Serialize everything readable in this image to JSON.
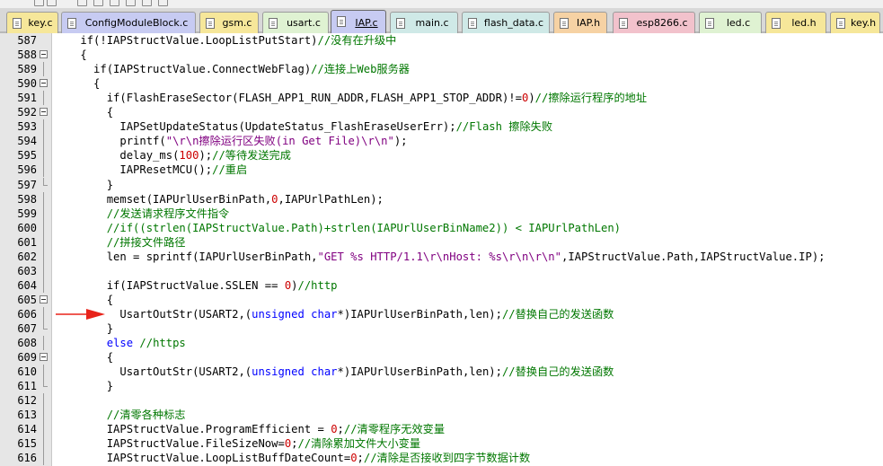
{
  "tabs": [
    {
      "label": "key.c",
      "color": "#f6e79a"
    },
    {
      "label": "ConfigModuleBlock.c",
      "color": "#c7cbf2"
    },
    {
      "label": "gsm.c",
      "color": "#f6e79a"
    },
    {
      "label": "usart.c",
      "color": "#dff2d2"
    },
    {
      "label": "IAP.c",
      "color": "#c7cbf2",
      "active": true
    },
    {
      "label": "main.c",
      "color": "#cfe9e7"
    },
    {
      "label": "flash_data.c",
      "color": "#cfe9e7"
    },
    {
      "label": "IAP.h",
      "color": "#f6d2a4"
    },
    {
      "label": "esp8266.c",
      "color": "#f2c2cc"
    },
    {
      "label": "led.c",
      "color": "#dff2d2"
    },
    {
      "label": "led.h",
      "color": "#f6e79a"
    },
    {
      "label": "key.h",
      "color": "#f6e79a"
    }
  ],
  "colors": {
    "comment": "#007700",
    "keyword": "#0000ff",
    "string": "#800080",
    "number": "#cc0000",
    "arrow": "#e8231a"
  },
  "current_line_marker": {
    "line": "606",
    "icon": "red-arrow-icon"
  },
  "lines": [
    {
      "n": "587",
      "fold": "none",
      "segs": [
        {
          "t": "    if(!IAPStructValue.LoopListPutStart)"
        },
        {
          "t": "//没有在升级中",
          "c": "comment"
        }
      ]
    },
    {
      "n": "588",
      "fold": "box",
      "segs": [
        {
          "t": "    {"
        }
      ]
    },
    {
      "n": "589",
      "fold": "line",
      "segs": [
        {
          "t": "      if(IAPStructValue.ConnectWebFlag)"
        },
        {
          "t": "//连接上Web服务器",
          "c": "comment"
        }
      ]
    },
    {
      "n": "590",
      "fold": "box",
      "segs": [
        {
          "t": "      {"
        }
      ]
    },
    {
      "n": "591",
      "fold": "line",
      "segs": [
        {
          "t": "        if(FlashEraseSector(FLASH_APP1_RUN_ADDR,FLASH_APP1_STOP_ADDR)!="
        },
        {
          "t": "0",
          "c": "number"
        },
        {
          "t": ")"
        },
        {
          "t": "//擦除运行程序的地址",
          "c": "comment"
        }
      ]
    },
    {
      "n": "592",
      "fold": "box",
      "segs": [
        {
          "t": "        {"
        }
      ]
    },
    {
      "n": "593",
      "fold": "line",
      "segs": [
        {
          "t": "          IAPSetUpdateStatus(UpdateStatus_FlashEraseUserErr);"
        },
        {
          "t": "//Flash 擦除失败",
          "c": "comment"
        }
      ]
    },
    {
      "n": "594",
      "fold": "line",
      "segs": [
        {
          "t": "          printf("
        },
        {
          "t": "\"\\r\\n擦除运行区失败(in Get File)\\r\\n\"",
          "c": "string"
        },
        {
          "t": ");"
        }
      ]
    },
    {
      "n": "595",
      "fold": "line",
      "segs": [
        {
          "t": "          delay_ms("
        },
        {
          "t": "100",
          "c": "number"
        },
        {
          "t": ");"
        },
        {
          "t": "//等待发送完成",
          "c": "comment"
        }
      ]
    },
    {
      "n": "596",
      "fold": "line",
      "segs": [
        {
          "t": "          IAPResetMCU();"
        },
        {
          "t": "//重启",
          "c": "comment"
        }
      ]
    },
    {
      "n": "597",
      "fold": "end",
      "segs": [
        {
          "t": "        }"
        }
      ]
    },
    {
      "n": "598",
      "fold": "line",
      "segs": [
        {
          "t": "        memset(IAPUrlUserBinPath,"
        },
        {
          "t": "0",
          "c": "number"
        },
        {
          "t": ",IAPUrlPathLen);"
        }
      ]
    },
    {
      "n": "599",
      "fold": "line",
      "segs": [
        {
          "t": "        //发送请求程序文件指令",
          "c": "comment"
        }
      ]
    },
    {
      "n": "600",
      "fold": "line",
      "segs": [
        {
          "t": "        //if((strlen(IAPStructValue.Path)+strlen(IAPUrlUserBinName2)) < IAPUrlPathLen)",
          "c": "comment"
        }
      ]
    },
    {
      "n": "601",
      "fold": "line",
      "segs": [
        {
          "t": "        //拼接文件路径",
          "c": "comment"
        }
      ]
    },
    {
      "n": "602",
      "fold": "line",
      "segs": [
        {
          "t": "        len = sprintf(IAPUrlUserBinPath,"
        },
        {
          "t": "\"GET %s HTTP/1.1\\r\\nHost: %s\\r\\n\\r\\n\"",
          "c": "string"
        },
        {
          "t": ",IAPStructValue.Path,IAPStructValue.IP);"
        }
      ]
    },
    {
      "n": "603",
      "fold": "line",
      "segs": [
        {
          "t": ""
        }
      ]
    },
    {
      "n": "604",
      "fold": "line",
      "segs": [
        {
          "t": "        if(IAPStructValue.SSLEN == "
        },
        {
          "t": "0",
          "c": "number"
        },
        {
          "t": ")"
        },
        {
          "t": "//http",
          "c": "comment"
        }
      ]
    },
    {
      "n": "605",
      "fold": "box",
      "segs": [
        {
          "t": "        {"
        }
      ]
    },
    {
      "n": "606",
      "fold": "line",
      "segs": [
        {
          "t": "          UsartOutStr(USART2,("
        },
        {
          "t": "unsigned",
          "c": "kw"
        },
        {
          "t": " "
        },
        {
          "t": "char",
          "c": "kw"
        },
        {
          "t": "*)IAPUrlUserBinPath,len);"
        },
        {
          "t": "//替换自己的发送函数",
          "c": "comment"
        }
      ]
    },
    {
      "n": "607",
      "fold": "end",
      "segs": [
        {
          "t": "        }"
        }
      ]
    },
    {
      "n": "608",
      "fold": "line",
      "segs": [
        {
          "t": "        "
        },
        {
          "t": "else",
          "c": "kw"
        },
        {
          "t": " "
        },
        {
          "t": "//https",
          "c": "comment"
        }
      ]
    },
    {
      "n": "609",
      "fold": "box",
      "segs": [
        {
          "t": "        {"
        }
      ]
    },
    {
      "n": "610",
      "fold": "line",
      "segs": [
        {
          "t": "          UsartOutStr(USART2,("
        },
        {
          "t": "unsigned",
          "c": "kw"
        },
        {
          "t": " "
        },
        {
          "t": "char",
          "c": "kw"
        },
        {
          "t": "*)IAPUrlUserBinPath,len);"
        },
        {
          "t": "//替换自己的发送函数",
          "c": "comment"
        }
      ]
    },
    {
      "n": "611",
      "fold": "end",
      "segs": [
        {
          "t": "        }"
        }
      ]
    },
    {
      "n": "612",
      "fold": "line",
      "segs": [
        {
          "t": ""
        }
      ]
    },
    {
      "n": "613",
      "fold": "line",
      "segs": [
        {
          "t": "        //清零各种标志",
          "c": "comment"
        }
      ]
    },
    {
      "n": "614",
      "fold": "line",
      "segs": [
        {
          "t": "        IAPStructValue.ProgramEfficient = "
        },
        {
          "t": "0",
          "c": "number"
        },
        {
          "t": ";"
        },
        {
          "t": "//清零程序无效变量",
          "c": "comment"
        }
      ]
    },
    {
      "n": "615",
      "fold": "line",
      "segs": [
        {
          "t": "        IAPStructValue.FileSizeNow="
        },
        {
          "t": "0",
          "c": "number"
        },
        {
          "t": ";"
        },
        {
          "t": "//清除累加文件大小变量",
          "c": "comment"
        }
      ]
    },
    {
      "n": "616",
      "fold": "line",
      "segs": [
        {
          "t": "        IAPStructValue.LoopListBuffDateCount="
        },
        {
          "t": "0",
          "c": "number"
        },
        {
          "t": ";"
        },
        {
          "t": "//清除是否接收到四字节数据计数",
          "c": "comment"
        }
      ]
    }
  ]
}
